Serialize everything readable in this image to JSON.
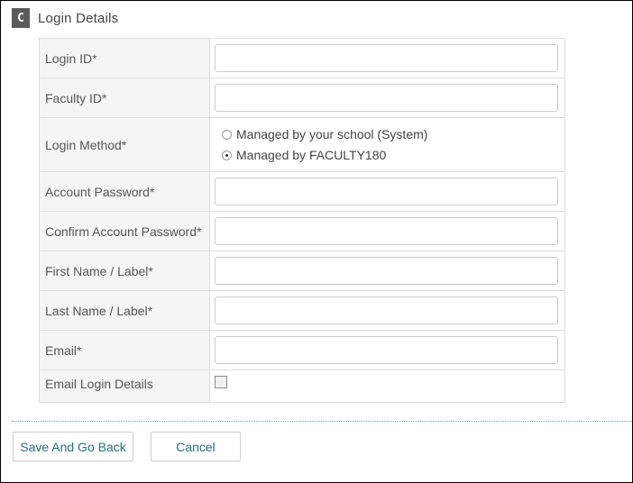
{
  "section": {
    "badge": "C",
    "title": "Login Details"
  },
  "form": {
    "login_id_label": "Login ID*",
    "faculty_id_label": "Faculty ID*",
    "login_method_label": "Login Method*",
    "login_method_options": [
      {
        "label": "Managed by your school (System)",
        "selected": false
      },
      {
        "label": "Managed by FACULTY180",
        "selected": true
      }
    ],
    "account_password_label": "Account Password*",
    "confirm_password_label": "Confirm Account Password*",
    "first_name_label": "First Name / Label*",
    "last_name_label": "Last Name / Label*",
    "email_label": "Email*",
    "email_login_details_label": "Email Login Details",
    "email_login_details_checked": false,
    "login_id_value": "",
    "faculty_id_value": "",
    "account_password_value": "",
    "confirm_password_value": "",
    "first_name_value": "",
    "last_name_value": "",
    "email_value": ""
  },
  "actions": {
    "save_label": "Save And Go Back",
    "cancel_label": "Cancel"
  }
}
